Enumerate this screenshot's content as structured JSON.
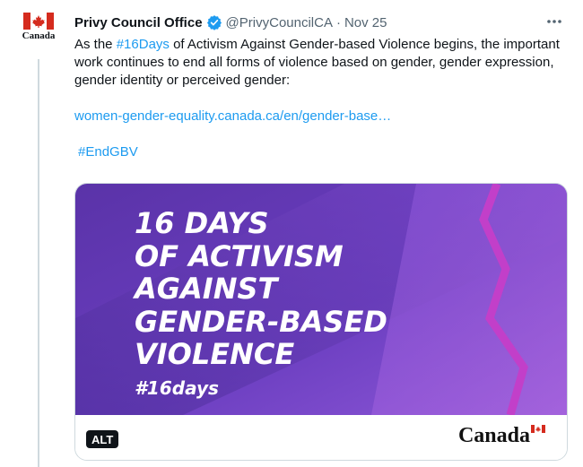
{
  "account": {
    "avatar_word": "Canada",
    "name": "Privy Council Office",
    "handle": "@PrivyCouncilCA",
    "separator": "·",
    "date": "Nov 25"
  },
  "tweet": {
    "text_before_tag": "As the ",
    "inline_hashtag": "#16Days",
    "text_after_tag": " of Activism Against Gender-based Violence begins, the important work continues to end all forms of violence based on gender, gender expression, gender identity or perceived gender:",
    "url": "women-gender-equality.canada.ca/en/gender-base…",
    "hashtag": "#EndGBV"
  },
  "media": {
    "headline_lines": [
      "16 DAYS",
      "OF ACTIVISM",
      "AGAINST",
      "GENDER-BASED",
      "VIOLENCE"
    ],
    "hashtag": "#16days",
    "alt_label": "ALT",
    "wordmark": "Canada"
  },
  "colors": {
    "link": "#1d9bf0",
    "verified": "#1d9bf0",
    "flag_red": "#d52b1e",
    "art_purple_dark": "#4b2a9a",
    "art_purple_light": "#8a4fd6",
    "art_magenta": "#c23fc9"
  },
  "icons": {
    "verified": "verified-badge-icon",
    "more": "more-horizontal-icon",
    "flag": "canada-flag-icon"
  }
}
